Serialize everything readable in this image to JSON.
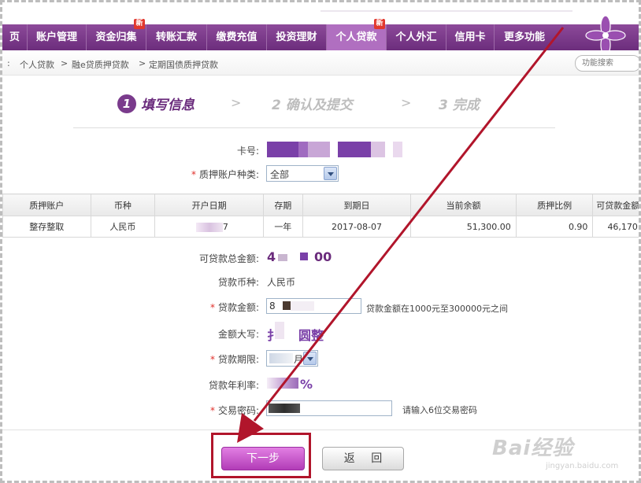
{
  "nav": {
    "items": [
      {
        "label": "页"
      },
      {
        "label": "账户管理"
      },
      {
        "label": "资金归集",
        "badge": "新"
      },
      {
        "label": "转账汇款"
      },
      {
        "label": "缴费充值"
      },
      {
        "label": "投资理财"
      },
      {
        "label": "个人贷款",
        "badge": "新",
        "active": true
      },
      {
        "label": "个人外汇"
      },
      {
        "label": "信用卡"
      },
      {
        "label": "更多功能"
      }
    ]
  },
  "breadcrumb": {
    "prefix": ":",
    "items": [
      "个人贷款",
      "融e贷质押贷款",
      "定期国债质押贷款"
    ]
  },
  "search": {
    "placeholder": "功能搜索"
  },
  "steps": [
    {
      "num": "1",
      "label": "填写信息"
    },
    {
      "label": "2 确认及提交"
    },
    {
      "label": "3 完成"
    }
  ],
  "form": {
    "card_label": "卡号:",
    "pledge_type_label": "质押账户种类:",
    "pledge_type_value": "全部",
    "total_label": "可贷款总金额:",
    "total_value_a": "4",
    "total_value_b": "00",
    "currency_label": "贷款币种:",
    "currency_value": "人民币",
    "amount_label": "贷款金额:",
    "amount_value": "8",
    "amount_hint": "贷款金额在1000元至300000元之间",
    "amount_caps_label": "金额大写:",
    "amount_caps_a": "扌",
    "amount_caps_b": "圆整",
    "term_label": "贷款期限:",
    "term_value": "月",
    "rate_label": "贷款年利率:",
    "rate_value": "%",
    "password_label": "交易密码:",
    "password_hint": "请输入6位交易密码"
  },
  "table": {
    "headers": [
      "质押账户",
      "币种",
      "开户日期",
      "存期",
      "到期日",
      "当前余额",
      "质押比例",
      "可贷款金额"
    ],
    "rows": [
      [
        "整存整取",
        "人民币",
        "7",
        "一年",
        "2017-08-07",
        "51,300.00",
        "0.90",
        "46,170"
      ]
    ]
  },
  "buttons": {
    "next": "下一步",
    "back": "返 回"
  },
  "watermark": {
    "main": "Bai经验",
    "sub": "jingyan.baidu.com"
  },
  "colors": {
    "brand": "#6c2d7c",
    "highlight": "#b1152b"
  }
}
